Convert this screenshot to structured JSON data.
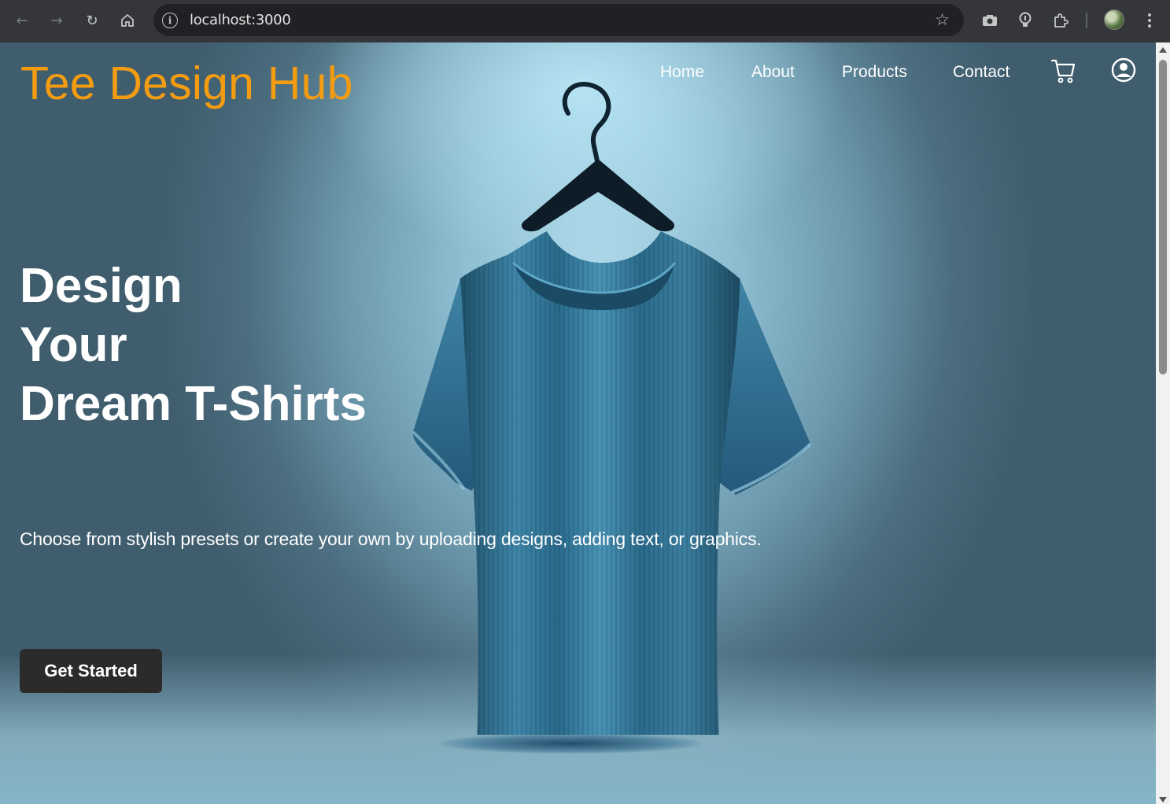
{
  "browser": {
    "url": "localhost:3000",
    "icons": [
      "back-icon",
      "forward-icon",
      "reload-icon",
      "home-icon",
      "site-info-icon",
      "bookmark-star-icon",
      "screenshot-icon",
      "lens-icon",
      "extensions-icon",
      "profile-avatar",
      "menu-icon"
    ]
  },
  "header": {
    "logo": "Tee Design Hub",
    "nav": [
      {
        "label": "Home"
      },
      {
        "label": "About"
      },
      {
        "label": "Products"
      },
      {
        "label": "Contact"
      }
    ],
    "icons": [
      "cart-icon",
      "user-account-icon"
    ]
  },
  "hero": {
    "title_lines": [
      "Design",
      "Your",
      "Dream T-Shirts"
    ],
    "subtitle": "Choose from stylish presets or create your own by uploading designs, adding text, or graphics.",
    "cta_label": "Get Started"
  },
  "colors": {
    "logo": "#f39c12",
    "cta_bg": "#2b2b2b",
    "chrome_bg": "#35363a",
    "shirt": "#2e6886"
  }
}
